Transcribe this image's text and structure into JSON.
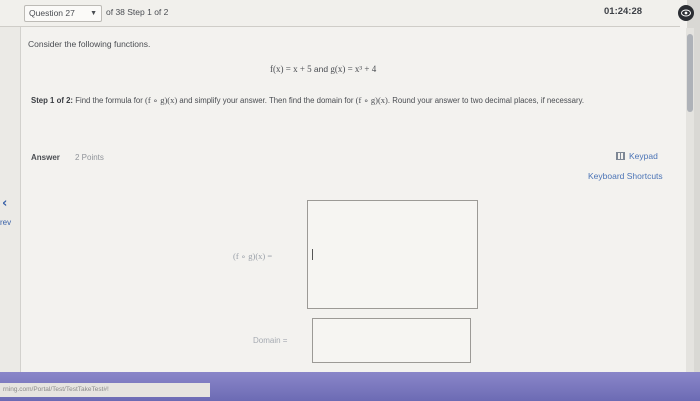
{
  "topbar": {
    "question_select": "Question 27",
    "of_text": "of 38 Step 1 of 2",
    "timer": "01:24:28"
  },
  "nav": {
    "prev_label": "rev"
  },
  "problem": {
    "prompt": "Consider the following functions.",
    "f_def": "f(x) = x + 5",
    "and_text": "and",
    "g_def": "g(x) = x³ + 4",
    "step_label": "Step 1 of 2:",
    "step_text_1": "Find the formula for",
    "composition": "(f ∘ g)(x)",
    "step_text_2": "and simplify your answer. Then find the domain for",
    "step_text_3": ". Round your answer to two decimal places, if necessary."
  },
  "answer": {
    "label": "Answer",
    "points": "2 Points",
    "keypad": "Keypad",
    "shortcuts": "Keyboard Shortcuts",
    "fg_label": "(f ∘ g)(x) =",
    "fg_value": "",
    "domain_label": "Domain =",
    "domain_value": ""
  },
  "status_bar": {
    "url": "rning.com/Portal/Test/TestTakeTest#!"
  },
  "colors": {
    "link": "#4b74b6",
    "bottom_bar": "#7674bd",
    "timer_icon_bg": "#2b2e33"
  },
  "icons": [
    "eye-icon",
    "keypad-icon",
    "chevron-left-icon",
    "caret-down-icon"
  ]
}
